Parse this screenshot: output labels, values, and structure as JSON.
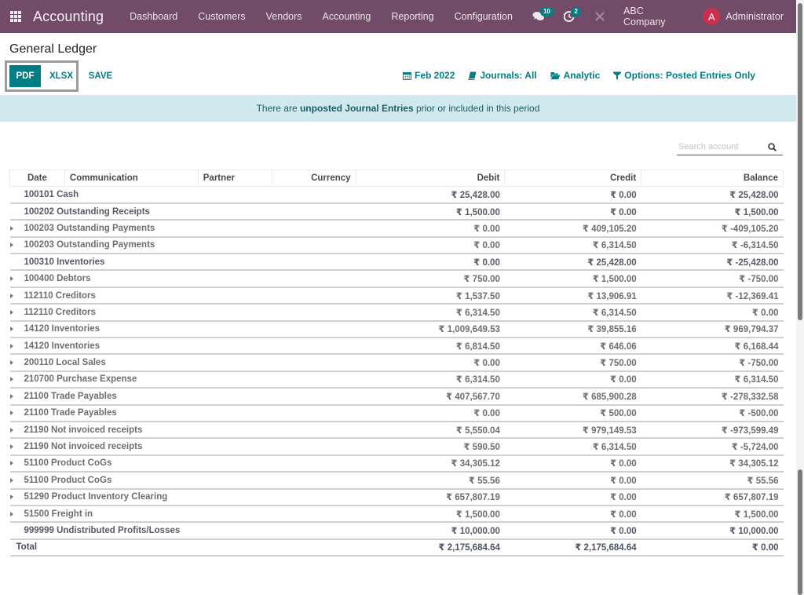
{
  "navbar": {
    "app_name": "Accounting",
    "menu": [
      "Dashboard",
      "Customers",
      "Vendors",
      "Accounting",
      "Reporting",
      "Configuration"
    ],
    "messages_badge": "10",
    "activities_badge": "2",
    "company": "ABC Company",
    "user_initial": "A",
    "user_name": "Administrator"
  },
  "page": {
    "title": "General Ledger",
    "buttons": {
      "pdf": "PDF",
      "xlsx": "XLSX",
      "save": "SAVE"
    },
    "filters": {
      "date": "Feb 2022",
      "journals": "Journals: All",
      "analytic": "Analytic",
      "options": "Options: Posted Entries Only"
    },
    "alert": {
      "prefix": "There are ",
      "bold": "unposted Journal Entries",
      "suffix": " prior or included in this period"
    },
    "search": {
      "placeholder": "Search account",
      "value": ""
    }
  },
  "colors": {
    "brand": "#714b67",
    "accent": "#017e84",
    "alert_bg": "#d0e9ee",
    "avatar": "#c9304c"
  },
  "table": {
    "headers": [
      "Date",
      "Communication",
      "Partner",
      "Currency",
      "Debit",
      "Credit",
      "Balance"
    ],
    "rows": [
      {
        "account": "100101 Cash",
        "debit": "₹ 25,428.00",
        "credit": "₹ 0.00",
        "balance": "₹ 25,428.00",
        "expandable": false
      },
      {
        "account": "100202 Outstanding Receipts",
        "debit": "₹ 1,500.00",
        "credit": "₹ 0.00",
        "balance": "₹ 1,500.00",
        "expandable": false
      },
      {
        "account": "100203 Outstanding Payments",
        "debit": "₹ 0.00",
        "credit": "₹ 409,105.20",
        "balance": "₹ -409,105.20",
        "expandable": true
      },
      {
        "account": "100203 Outstanding Payments",
        "debit": "₹ 0.00",
        "credit": "₹ 6,314.50",
        "balance": "₹ -6,314.50",
        "expandable": true
      },
      {
        "account": "100310 Inventories",
        "debit": "₹ 0.00",
        "credit": "₹ 25,428.00",
        "balance": "₹ -25,428.00",
        "expandable": false
      },
      {
        "account": "100400 Debtors",
        "debit": "₹ 750.00",
        "credit": "₹ 1,500.00",
        "balance": "₹ -750.00",
        "expandable": true
      },
      {
        "account": "112110 Creditors",
        "debit": "₹ 1,537.50",
        "credit": "₹ 13,906.91",
        "balance": "₹ -12,369.41",
        "expandable": true
      },
      {
        "account": "112110 Creditors",
        "debit": "₹ 6,314.50",
        "credit": "₹ 6,314.50",
        "balance": "₹ 0.00",
        "expandable": true
      },
      {
        "account": "14120 Inventories",
        "debit": "₹ 1,009,649.53",
        "credit": "₹ 39,855.16",
        "balance": "₹ 969,794.37",
        "expandable": true
      },
      {
        "account": "14120 Inventories",
        "debit": "₹ 6,814.50",
        "credit": "₹ 646.06",
        "balance": "₹ 6,168.44",
        "expandable": true
      },
      {
        "account": "200110 Local Sales",
        "debit": "₹ 0.00",
        "credit": "₹ 750.00",
        "balance": "₹ -750.00",
        "expandable": true
      },
      {
        "account": "210700 Purchase Expense",
        "debit": "₹ 6,314.50",
        "credit": "₹ 0.00",
        "balance": "₹ 6,314.50",
        "expandable": true
      },
      {
        "account": "21100 Trade Payables",
        "debit": "₹ 407,567.70",
        "credit": "₹ 685,900.28",
        "balance": "₹ -278,332.58",
        "expandable": true
      },
      {
        "account": "21100 Trade Payables",
        "debit": "₹ 0.00",
        "credit": "₹ 500.00",
        "balance": "₹ -500.00",
        "expandable": true
      },
      {
        "account": "21190 Not invoiced receipts",
        "debit": "₹ 5,550.04",
        "credit": "₹ 979,149.53",
        "balance": "₹ -973,599.49",
        "expandable": true
      },
      {
        "account": "21190 Not invoiced receipts",
        "debit": "₹ 590.50",
        "credit": "₹ 6,314.50",
        "balance": "₹ -5,724.00",
        "expandable": true
      },
      {
        "account": "51100 Product CoGs",
        "debit": "₹ 34,305.12",
        "credit": "₹ 0.00",
        "balance": "₹ 34,305.12",
        "expandable": true
      },
      {
        "account": "51100 Product CoGs",
        "debit": "₹ 55.56",
        "credit": "₹ 0.00",
        "balance": "₹ 55.56",
        "expandable": true
      },
      {
        "account": "51290 Product Inventory Clearing",
        "debit": "₹ 657,807.19",
        "credit": "₹ 0.00",
        "balance": "₹ 657,807.19",
        "expandable": true
      },
      {
        "account": "51500 Freight in",
        "debit": "₹ 1,500.00",
        "credit": "₹ 0.00",
        "balance": "₹ 1,500.00",
        "expandable": true
      },
      {
        "account": "999999 Undistributed Profits/Losses",
        "debit": "₹ 10,000.00",
        "credit": "₹ 0.00",
        "balance": "₹ 10,000.00",
        "expandable": false
      }
    ],
    "total": {
      "label": "Total",
      "debit": "₹ 2,175,684.64",
      "credit": "₹ 2,175,684.64",
      "balance": "₹ 0.00"
    }
  }
}
